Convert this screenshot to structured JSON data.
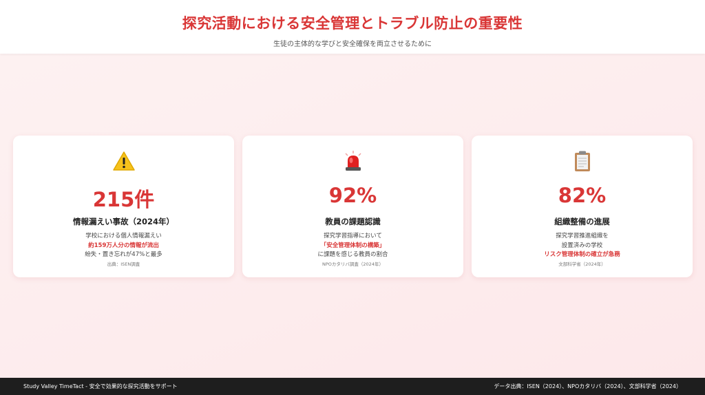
{
  "header": {
    "title": "探究活動における安全管理とトラブル防止の重要性",
    "subtitle": "生徒の主体的な学びと安全確保を両立させるために"
  },
  "cards": [
    {
      "icon": "warning-icon",
      "value": "215件",
      "label": "情報漏えい事故（2024年）",
      "desc1": "学校における個人情報漏えい",
      "highlight": "約159万人分の情報が流出",
      "desc3": "紛失・置き忘れが47%と最多",
      "source": "出典：ISEN調査"
    },
    {
      "icon": "siren-icon",
      "value": "92%",
      "label": "教員の課題認識",
      "desc1": "探究学習指導において",
      "highlight": "「安全管理体制の構築」",
      "desc3": "に課題を感じる教員の割合",
      "source": "NPOカタリバ調査（2024年）"
    },
    {
      "icon": "clipboard-icon",
      "value": "82%",
      "label": "組織整備の進展",
      "desc1": "探究学習推進組織を",
      "desc2": "設置済みの学校",
      "highlight": "リスク管理体制の確立が急務",
      "source": "文部科学省（2024年）"
    }
  ],
  "footer": {
    "left": "Study Valley TimeTact - 安全で効果的な探究活動をサポート",
    "right": "データ出典：ISEN（2024）、NPOカタリバ（2024）、文部科学省（2024）"
  },
  "colors": {
    "accent": "#d93636",
    "footer_bg": "#1e1e1e",
    "background": "#fdecee"
  }
}
